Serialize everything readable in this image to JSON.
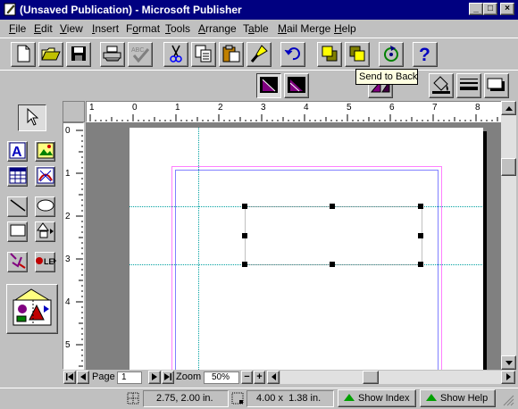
{
  "window": {
    "title": "(Unsaved Publication) - Microsoft Publisher",
    "minimize_glyph": "_",
    "maximize_glyph": "□",
    "close_glyph": "×"
  },
  "menu": [
    {
      "pre": "",
      "key": "F",
      "post": "ile"
    },
    {
      "pre": "",
      "key": "E",
      "post": "dit"
    },
    {
      "pre": "",
      "key": "V",
      "post": "iew"
    },
    {
      "pre": "",
      "key": "I",
      "post": "nsert"
    },
    {
      "pre": "F",
      "key": "o",
      "post": "rmat"
    },
    {
      "pre": "",
      "key": "T",
      "post": "ools"
    },
    {
      "pre": "",
      "key": "A",
      "post": "rrange"
    },
    {
      "pre": "T",
      "key": "a",
      "post": "ble"
    },
    {
      "pre": "",
      "key": "M",
      "post": "ail Merge"
    },
    {
      "pre": "",
      "key": "H",
      "post": "elp"
    }
  ],
  "tooltip": "Send to Back",
  "ruler": {
    "h_labels": [
      "1",
      "0",
      "1",
      "2",
      "3",
      "4",
      "5",
      "6",
      "7",
      "8"
    ],
    "v_labels": [
      "0",
      "1",
      "2",
      "3",
      "4",
      "5"
    ]
  },
  "nav": {
    "page_label": "Page",
    "page_value": "1",
    "zoom_label": "Zoom",
    "zoom_value": "50%",
    "minus": "−",
    "plus": "+"
  },
  "status": {
    "position": "2.75, 2.00 in.",
    "size": "4.00 x  1.38 in.",
    "show_index": "Show Index",
    "show_help": "Show Help"
  },
  "icons": {
    "new": "new-document-icon",
    "open": "open-folder-icon",
    "save": "save-icon",
    "print": "print-icon",
    "spell": "spell-check-icon",
    "cut": "cut-icon",
    "copy": "copy-icon",
    "paste": "paste-icon",
    "format_painter": "format-painter-icon",
    "undo": "undo-icon",
    "bring_front": "bring-to-front-icon",
    "send_back": "send-to-back-icon",
    "rotate": "custom-rotate-icon",
    "help": "help-icon"
  }
}
